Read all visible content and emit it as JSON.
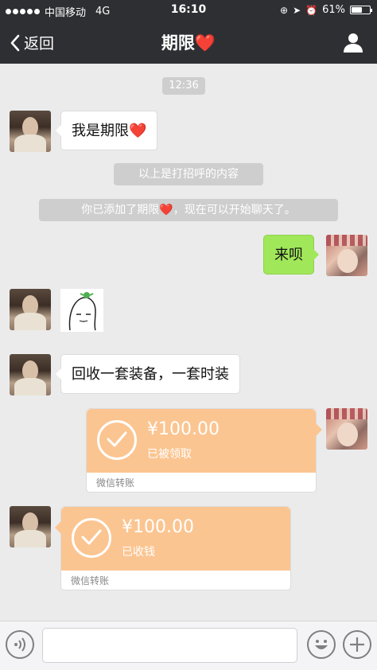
{
  "status_bar": {
    "carrier": "中国移动",
    "network": "4G",
    "time": "16:10",
    "battery": "61%",
    "battery_level": 0.61
  },
  "nav": {
    "back_label": "返回",
    "title_text": "期限",
    "title_heart": "❤️"
  },
  "chat": {
    "timestamp": "12:36",
    "msg1_text": "我是期限",
    "msg1_heart": "❤️",
    "sys1": "以上是打招呼的内容",
    "sys2_a": "你已添加了期限",
    "sys2_heart": "❤️",
    "sys2_b": "，现在可以开始聊天了。",
    "msg2_text": "来呗",
    "msg3_text": "回收一套装备，一套时装",
    "transfer1": {
      "amount": "¥100.00",
      "status": "已被领取",
      "label": "微信转账"
    },
    "transfer2": {
      "amount": "¥100.00",
      "status": "已收钱",
      "label": "微信转账"
    }
  },
  "icons": {
    "back": "chevron-left-icon",
    "profile": "person-icon",
    "voice": "voice-icon",
    "emoji": "emoji-icon",
    "plus": "plus-icon",
    "check": "check-icon"
  },
  "colors": {
    "nav_bg": "#2e2f33",
    "chat_bg": "#ebebeb",
    "my_bubble": "#a0e75a",
    "transfer": "#fbc591"
  }
}
